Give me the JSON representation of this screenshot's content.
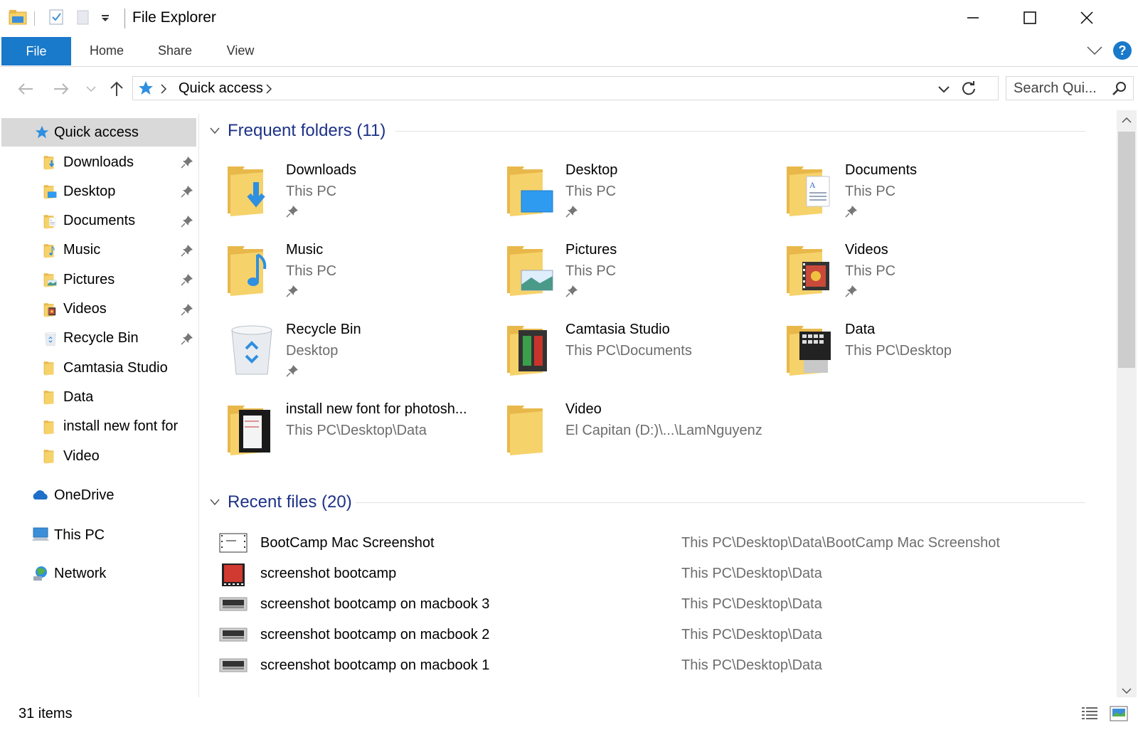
{
  "window": {
    "title": "File Explorer"
  },
  "ribbon": {
    "tabs": [
      {
        "label": "File"
      },
      {
        "label": "Home"
      },
      {
        "label": "Share"
      },
      {
        "label": "View"
      }
    ],
    "help_label": "?"
  },
  "address": {
    "breadcrumb": "Quick access",
    "search_placeholder": "Search Qui..."
  },
  "navpane": {
    "quick_access": "Quick access",
    "items": [
      {
        "label": "Downloads",
        "icon": "downloads-folder-icon",
        "pinned": true
      },
      {
        "label": "Desktop",
        "icon": "desktop-folder-icon",
        "pinned": true
      },
      {
        "label": "Documents",
        "icon": "documents-folder-icon",
        "pinned": true
      },
      {
        "label": "Music",
        "icon": "music-folder-icon",
        "pinned": true
      },
      {
        "label": "Pictures",
        "icon": "pictures-folder-icon",
        "pinned": true
      },
      {
        "label": "Videos",
        "icon": "videos-folder-icon",
        "pinned": true
      },
      {
        "label": "Recycle Bin",
        "icon": "recycle-bin-icon",
        "pinned": true
      },
      {
        "label": "Camtasia Studio",
        "icon": "folder-icon",
        "pinned": false
      },
      {
        "label": "Data",
        "icon": "folder-icon",
        "pinned": false
      },
      {
        "label": "install new font for",
        "icon": "folder-icon",
        "pinned": false
      },
      {
        "label": "Video",
        "icon": "folder-icon",
        "pinned": false
      }
    ],
    "onedrive": "OneDrive",
    "this_pc": "This PC",
    "network": "Network"
  },
  "frequent": {
    "header": "Frequent folders (11)",
    "folders": [
      {
        "name": "Downloads",
        "path": "This PC",
        "pinned": true,
        "icon": "downloads-folder-icon"
      },
      {
        "name": "Desktop",
        "path": "This PC",
        "pinned": true,
        "icon": "desktop-folder-icon"
      },
      {
        "name": "Documents",
        "path": "This PC",
        "pinned": true,
        "icon": "documents-folder-icon"
      },
      {
        "name": "Music",
        "path": "This PC",
        "pinned": true,
        "icon": "music-folder-icon"
      },
      {
        "name": "Pictures",
        "path": "This PC",
        "pinned": true,
        "icon": "pictures-folder-icon"
      },
      {
        "name": "Videos",
        "path": "This PC",
        "pinned": true,
        "icon": "videos-folder-icon"
      },
      {
        "name": "Recycle Bin",
        "path": "Desktop",
        "pinned": true,
        "icon": "recycle-bin-icon"
      },
      {
        "name": "Camtasia Studio",
        "path": "This PC\\Documents",
        "pinned": false,
        "icon": "camtasia-folder-icon"
      },
      {
        "name": "Data",
        "path": "This PC\\Desktop",
        "pinned": false,
        "icon": "data-folder-icon"
      },
      {
        "name": "install new font for photosh...",
        "path": "This PC\\Desktop\\Data",
        "pinned": false,
        "icon": "font-folder-icon"
      },
      {
        "name": "Video",
        "path": "El Capitan (D:)\\...\\LamNguyenz",
        "pinned": false,
        "icon": "folder-icon"
      }
    ]
  },
  "recent": {
    "header": "Recent files (20)",
    "files": [
      {
        "name": "BootCamp Mac Screenshot",
        "path": "This PC\\Desktop\\Data\\BootCamp Mac Screenshot"
      },
      {
        "name": "screenshot bootcamp",
        "path": "This PC\\Desktop\\Data"
      },
      {
        "name": "screenshot bootcamp on macbook 3",
        "path": "This PC\\Desktop\\Data"
      },
      {
        "name": "screenshot bootcamp on macbook 2",
        "path": "This PC\\Desktop\\Data"
      },
      {
        "name": "screenshot bootcamp on macbook 1",
        "path": "This PC\\Desktop\\Data"
      }
    ]
  },
  "status": {
    "item_count": "31 items"
  },
  "colors": {
    "accent": "#1979ca",
    "header_text": "#1e3287",
    "folder": "#f6d26b",
    "folder_dark": "#e8b84a",
    "secondary_text": "#6d6d6d"
  }
}
